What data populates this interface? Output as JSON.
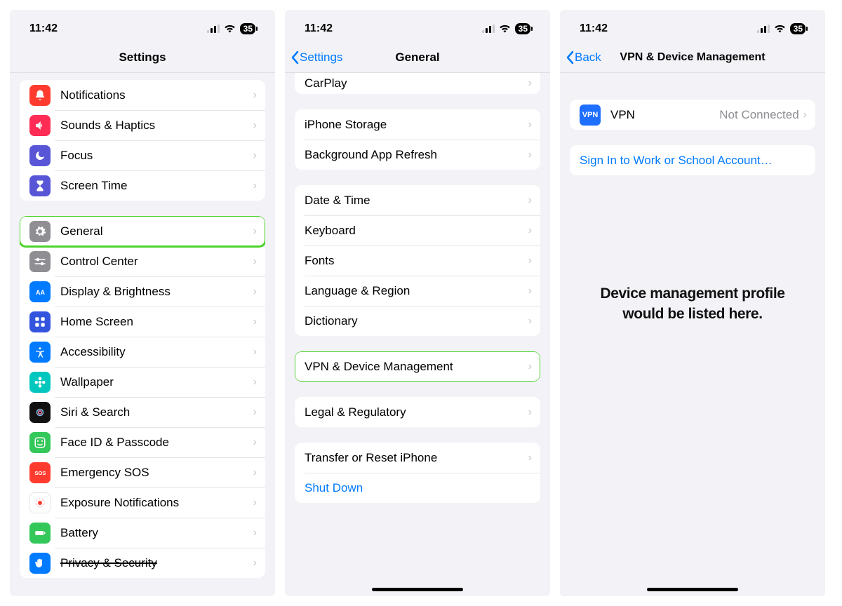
{
  "status": {
    "time": "11:42",
    "battery": "35"
  },
  "screen1": {
    "title": "Settings",
    "rows": {
      "notifications": "Notifications",
      "sounds": "Sounds & Haptics",
      "focus": "Focus",
      "screentime": "Screen Time",
      "general": "General",
      "control": "Control Center",
      "display": "Display & Brightness",
      "home": "Home Screen",
      "accessibility": "Accessibility",
      "wallpaper": "Wallpaper",
      "siri": "Siri & Search",
      "faceid": "Face ID & Passcode",
      "sos": "Emergency SOS",
      "exposure": "Exposure Notifications",
      "battery": "Battery",
      "privacy": "Privacy & Security"
    }
  },
  "screen2": {
    "back": "Settings",
    "title": "General",
    "rows": {
      "carplay": "CarPlay",
      "storage": "iPhone Storage",
      "bgrefresh": "Background App Refresh",
      "datetime": "Date & Time",
      "keyboard": "Keyboard",
      "fonts": "Fonts",
      "lang": "Language & Region",
      "dict": "Dictionary",
      "vpn": "VPN & Device Management",
      "legal": "Legal & Regulatory",
      "transfer": "Transfer or Reset iPhone",
      "shutdown": "Shut Down"
    }
  },
  "screen3": {
    "back": "Back",
    "title": "VPN & Device Management",
    "vpn_label": "VPN",
    "vpn_status": "Not Connected",
    "signin": "Sign In to Work or School Account…",
    "annotation_l1": "Device management profile",
    "annotation_l2": "would be listed here."
  },
  "_icons": {
    "notifications": [
      "#ff3b30",
      "bell"
    ],
    "sounds": [
      "#ff2d55",
      "speaker"
    ],
    "focus": [
      "#5856d6",
      "moon"
    ],
    "screentime": [
      "#5856d6",
      "hourglass"
    ],
    "general": [
      "gear-gray",
      "gear"
    ],
    "control": [
      "#8e8e93",
      "sliders"
    ],
    "display": [
      "#007aff",
      "aa"
    ],
    "home": [
      "#3355dd",
      "grid"
    ],
    "accessibility": [
      "#007aff",
      "access"
    ],
    "wallpaper": [
      "#00c7be",
      "flower"
    ],
    "siri": [
      "#111",
      "siri"
    ],
    "faceid": [
      "#34c759",
      "face"
    ],
    "sos": [
      "#ff3b30",
      "sos"
    ],
    "exposure": [
      "#ffffff",
      "exposure"
    ],
    "battery": [
      "#34c759",
      "batt"
    ],
    "privacy": [
      "#007aff",
      "hand"
    ]
  }
}
